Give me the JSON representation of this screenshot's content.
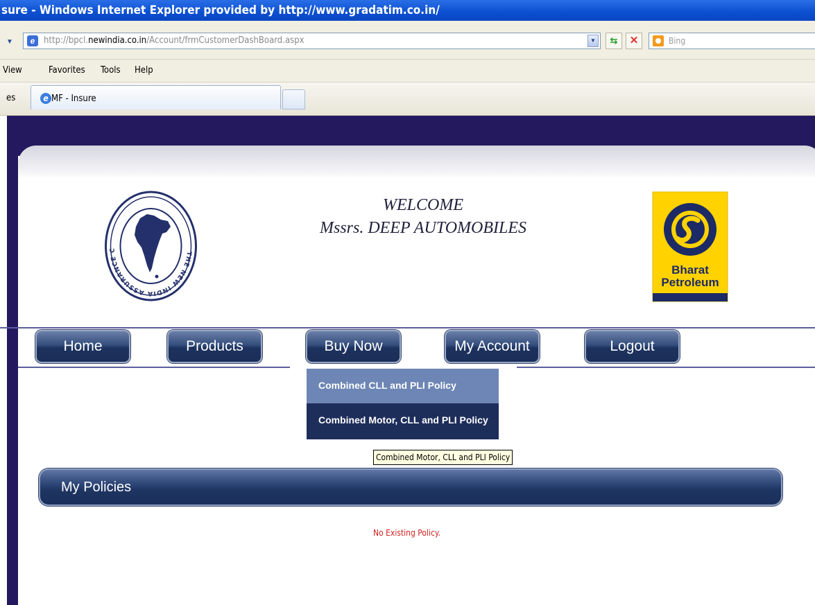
{
  "window": {
    "title": "sure - Windows Internet Explorer provided by http://www.gradatim.co.in/"
  },
  "address_bar": {
    "url_prefix": "http://bpcl.",
    "url_domain": "newindia.co.in",
    "url_suffix": "/Account/frmCustomerDashBoard.aspx",
    "search_placeholder": "Bing"
  },
  "menu": {
    "items": [
      "View",
      "Favorites",
      "Tools",
      "Help"
    ]
  },
  "tabs": {
    "favorites_fragment": "es",
    "active_tab_label": "MF - Insure"
  },
  "header": {
    "welcome_line1": "WELCOME",
    "welcome_line2": "Mssrs. DEEP AUTOMOBILES",
    "nia_seal_text": "THE NEW INDIA ASSURANCE CO. LTD.",
    "bpcl_logo_line1": "Bharat",
    "bpcl_logo_line2": "Petroleum"
  },
  "nav": {
    "home": "Home",
    "products": "Products",
    "buy_now": "Buy Now",
    "my_account": "My Account",
    "logout": "Logout"
  },
  "buy_now_menu": {
    "item1": "Combined CLL and PLI Policy",
    "item2": "Combined Motor, CLL and PLI Policy"
  },
  "tooltip": "Combined Motor, CLL and PLI Policy",
  "policies": {
    "title": "My Policies",
    "empty_message": "No Existing Policy."
  },
  "colors": {
    "nav_dark": "#1d325e",
    "dropdown_highlight": "#6d86b5",
    "header_band": "#24195f",
    "error_text": "#d21f1f"
  }
}
